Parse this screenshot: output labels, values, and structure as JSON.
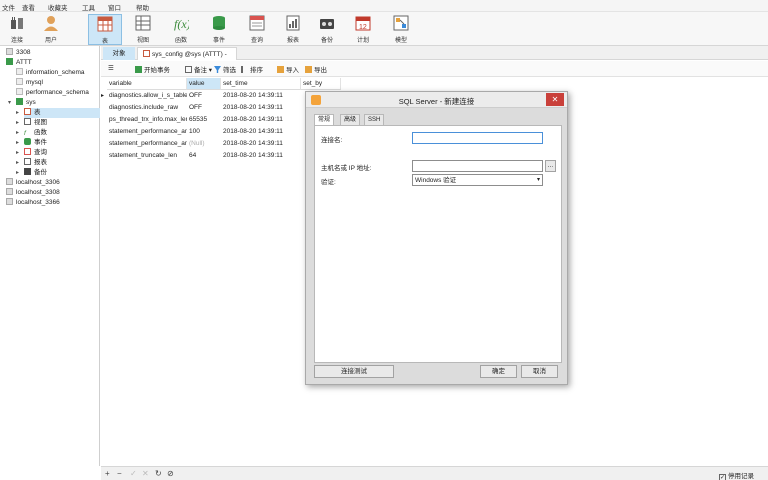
{
  "menu": [
    "文件",
    "查看",
    "收藏夹",
    "工具",
    "窗口",
    "帮助"
  ],
  "toolbar": {
    "connect": "连接",
    "user": "用户",
    "table": "表",
    "view": "视图",
    "function": "函数",
    "event": "事件",
    "query": "查询",
    "report": "报表",
    "backup": "备份",
    "schedule": "计划",
    "model": "模型"
  },
  "sidebar": {
    "items": [
      "3308",
      "ATTT",
      "information_schema",
      "mysql",
      "performance_schema",
      "sys",
      "表",
      "视图",
      "函数",
      "事件",
      "查询",
      "报表",
      "备份",
      "localhost_3306",
      "localhost_3308",
      "localhost_3366"
    ]
  },
  "tabs": {
    "objects": "对象",
    "table": "sys_config @sys (ATTT) - 表"
  },
  "subtoolbar": {
    "begin_tx": "开始事务",
    "note": "备注",
    "filter": "筛选",
    "sort": "排序",
    "import": "导入",
    "export": "导出"
  },
  "grid": {
    "columns": [
      "variable",
      "value",
      "set_time",
      "set_by"
    ],
    "rows": [
      [
        "diagnostics.allow_i_s_tables",
        "OFF",
        "2018-08-20 14:39:11",
        ""
      ],
      [
        "diagnostics.include_raw",
        "OFF",
        "2018-08-20 14:39:11",
        ""
      ],
      [
        "ps_thread_trx_info.max_length",
        "65535",
        "2018-08-20 14:39:11",
        ""
      ],
      [
        "statement_performance_analyzer.limit",
        "100",
        "2018-08-20 14:39:11",
        ""
      ],
      [
        "statement_performance_analyzer.view",
        "(Null)",
        "2018-08-20 14:39:11",
        ""
      ],
      [
        "statement_truncate_len",
        "64",
        "2018-08-20 14:39:11",
        ""
      ]
    ]
  },
  "bottombar": {
    "icons": [
      "+",
      "−",
      "✓",
      "✕",
      "↻",
      "⊘"
    ],
    "stop_records": "停用记录"
  },
  "dialog": {
    "title": "SQL Server - 新建连接",
    "close": "✕",
    "tabs": [
      "常规",
      "高级",
      "SSH"
    ],
    "conn_name_label": "连接名:",
    "conn_name_value": "",
    "host_label": "主机名或 IP 地址:",
    "host_value": "",
    "browse": "...",
    "auth_label": "验证:",
    "auth_value": "Windows 验证",
    "test_button": "连接测试",
    "ok_button": "确定",
    "cancel_button": "取消"
  }
}
